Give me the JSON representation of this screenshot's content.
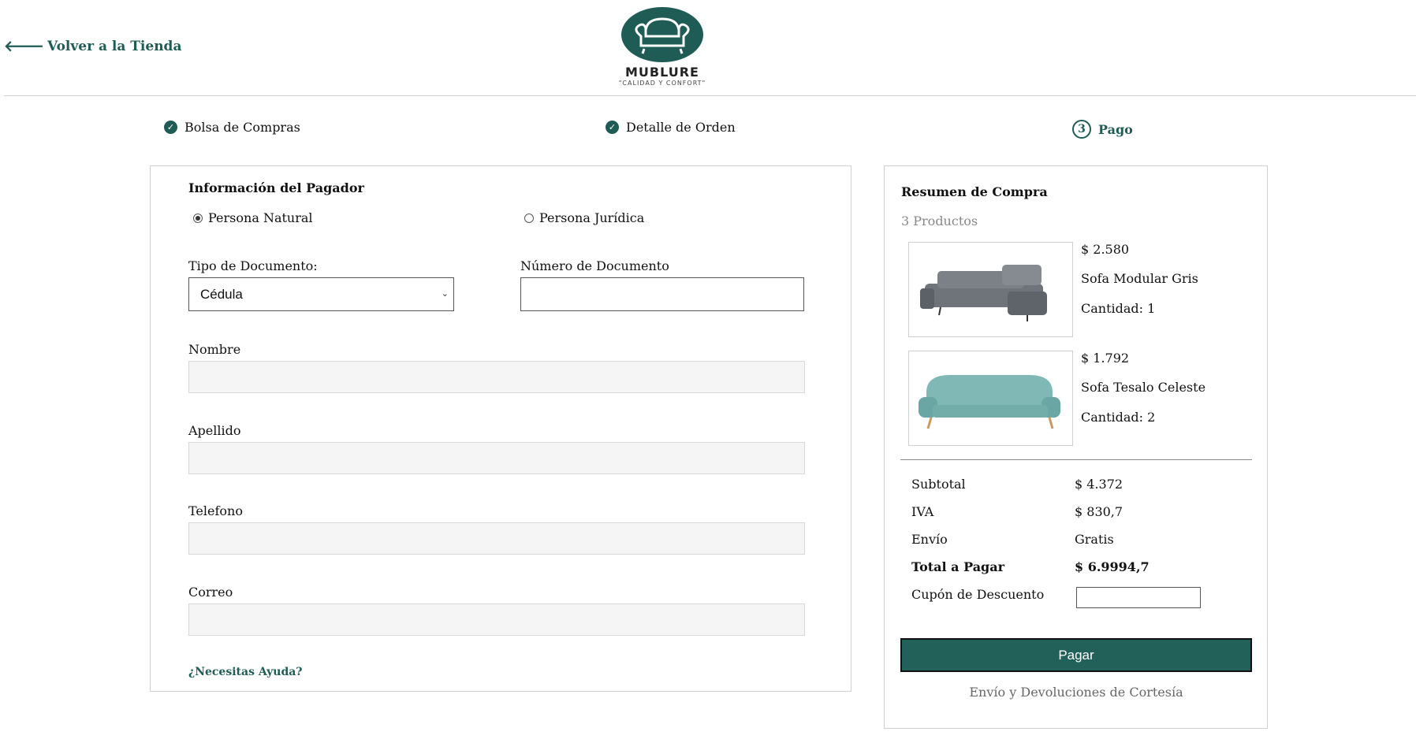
{
  "header": {
    "back_label": "Volver a la Tienda",
    "brand": "MUBLURE",
    "tagline": "\"CALIDAD Y CONFORT\""
  },
  "steps": [
    {
      "label": "Bolsa de Compras",
      "status": "done"
    },
    {
      "label": "Detalle de Orden",
      "status": "done"
    },
    {
      "label": "Pago",
      "number": "3",
      "status": "current"
    }
  ],
  "payer": {
    "title": "Información del Pagador",
    "person_type_options": [
      {
        "label": "Persona Natural",
        "selected": true
      },
      {
        "label": "Persona Jurídica",
        "selected": false
      }
    ],
    "doc_type_label": "Tipo de Documento:",
    "doc_type_value": "Cédula",
    "doc_number_label": "Número de Documento",
    "doc_number_value": "",
    "name_label": "Nombre",
    "name_value": "",
    "lastname_label": "Apellido",
    "lastname_value": "",
    "phone_label": "Telefono",
    "phone_value": "",
    "email_label": "Correo",
    "email_value": "",
    "help_label": "¿Necesitas Ayuda?"
  },
  "summary": {
    "title": "Resumen de Compra",
    "count": "3 Productos",
    "items": [
      {
        "price": "$ 2.580",
        "name": "Sofa Modular Gris",
        "qty": "Cantidad: 1",
        "image": "grey-modular-sofa"
      },
      {
        "price": "$ 1.792",
        "name": "Sofa Tesalo Celeste",
        "qty": "Cantidad: 2",
        "image": "teal-sofa"
      }
    ],
    "subtotal_label": "Subtotal",
    "subtotal_value": "$ 4.372",
    "iva_label": "IVA",
    "iva_value": "$ 830,7",
    "shipping_label": "Envío",
    "shipping_value": "Gratis",
    "total_label": "Total a Pagar",
    "total_value": "$ 6.9994,7",
    "coupon_label": "Cupón de Descuento",
    "coupon_value": "",
    "pay_label": "Pagar",
    "courtesy": "Envío y Devoluciones de Cortesía"
  },
  "colors": {
    "accent": "#1f5c56",
    "button": "#22605a",
    "border": "#cfcfcf",
    "field_bg": "#f5f5f5"
  }
}
